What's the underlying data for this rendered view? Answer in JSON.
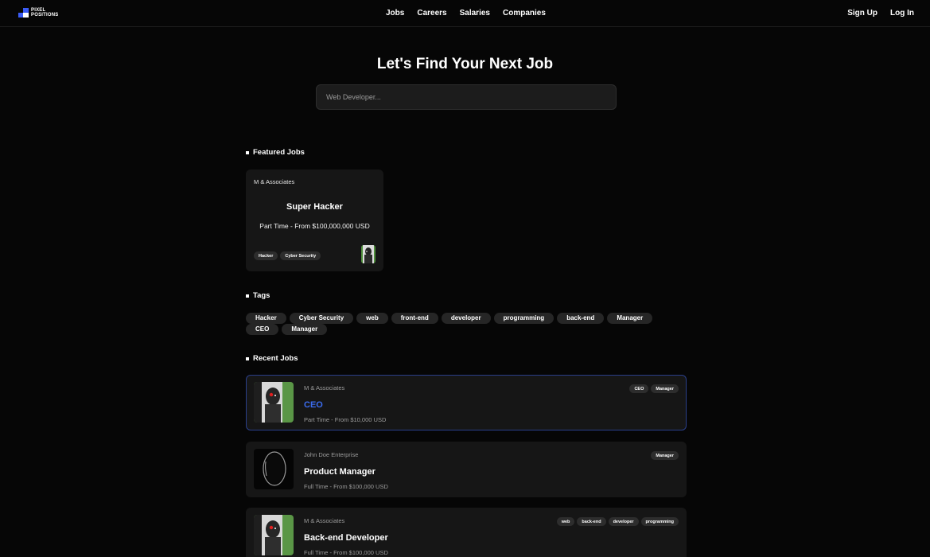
{
  "nav": {
    "logo_line1": "PIXEL",
    "logo_line2": "POSITIONS",
    "links": [
      "Jobs",
      "Careers",
      "Salaries",
      "Companies"
    ],
    "sign_up": "Sign Up",
    "log_in": "Log In"
  },
  "hero": {
    "title": "Let's Find Your Next Job",
    "search_placeholder": "Web Developer..."
  },
  "featured": {
    "heading": "Featured Jobs",
    "card": {
      "employer": "M & Associates",
      "title": "Super Hacker",
      "salary": "Part Time - From $100,000,000 USD",
      "tags": [
        "Hacker",
        "Cyber Security"
      ]
    }
  },
  "tags": {
    "heading": "Tags",
    "items": [
      "Hacker",
      "Cyber Security",
      "web",
      "front-end",
      "developer",
      "programming",
      "back-end",
      "Manager",
      "CEO",
      "Manager"
    ]
  },
  "recent": {
    "heading": "Recent Jobs",
    "jobs": [
      {
        "employer": "M & Associates",
        "title": "CEO",
        "salary": "Part Time - From $10,000 USD",
        "tags": [
          "CEO",
          "Manager"
        ]
      },
      {
        "employer": "John Doe Enterprise",
        "title": "Product Manager",
        "salary": "Full Time - From $100,000 USD",
        "tags": [
          "Manager"
        ]
      },
      {
        "employer": "M & Associates",
        "title": "Back-end Developer",
        "salary": "Full Time - From $100,000 USD",
        "tags": [
          "web",
          "back-end",
          "developer",
          "programming"
        ]
      }
    ]
  },
  "colors": {
    "background": "#060606",
    "card": "#161616",
    "accent_blue": "#3b6cf0",
    "active_border": "#2a3f8a",
    "tag_bg": "#262626"
  }
}
